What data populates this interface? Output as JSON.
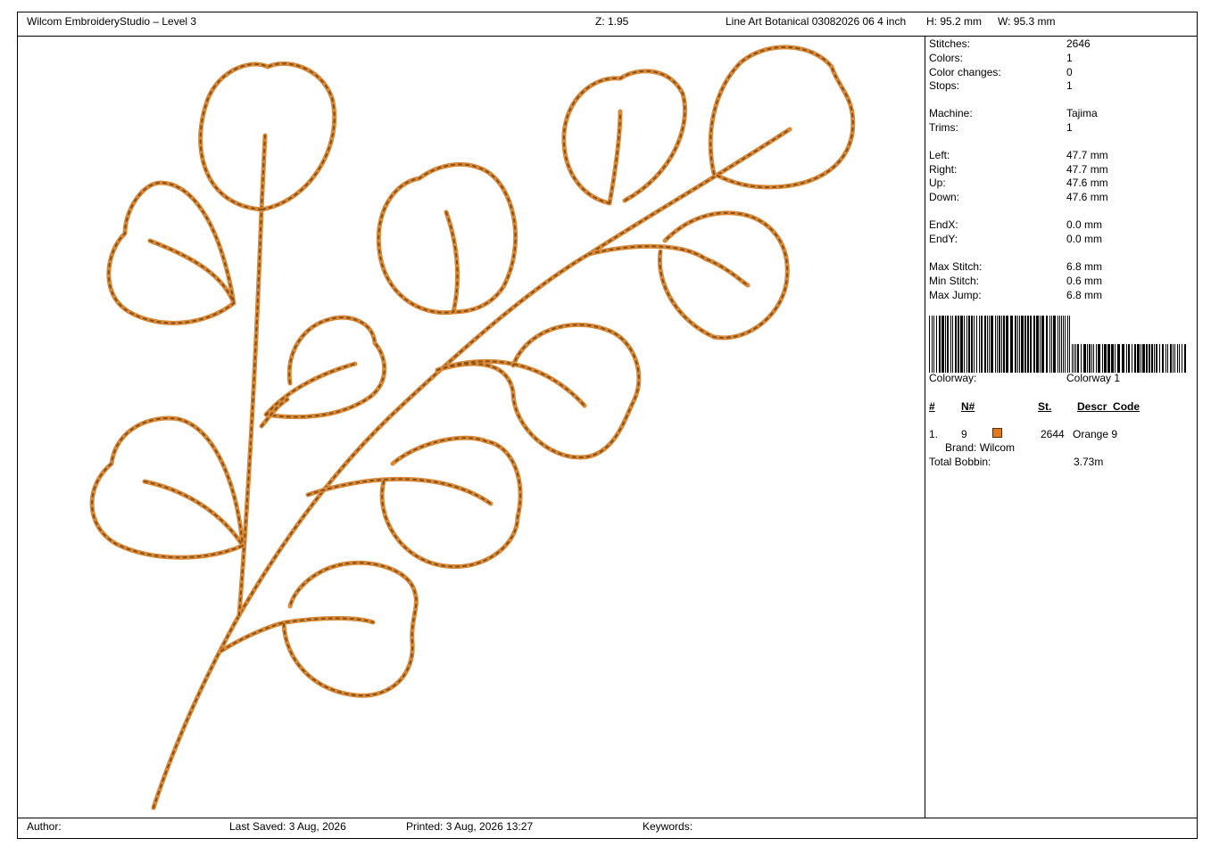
{
  "header": {
    "app_title": "Wilcom EmbroideryStudio – Level 3",
    "zoom": "Z: 1.95",
    "design_name": "Line Art Botanical 03082026 06 4  inch",
    "height": "H: 95.2 mm",
    "width": "W: 95.3 mm"
  },
  "stats": [
    {
      "label": "Stitches:",
      "value": "2646"
    },
    {
      "label": "Colors:",
      "value": "1"
    },
    {
      "label": "Color changes:",
      "value": "0"
    },
    {
      "label": "Stops:",
      "value": "1"
    },
    {
      "label": "Machine:",
      "value": "Tajima"
    },
    {
      "label": "Trims:",
      "value": "1"
    },
    {
      "label": "Left:",
      "value": "47.7 mm"
    },
    {
      "label": "Right:",
      "value": "47.7 mm"
    },
    {
      "label": "Up:",
      "value": "47.6 mm"
    },
    {
      "label": "Down:",
      "value": "47.6 mm"
    },
    {
      "label": "EndX:",
      "value": "0.0 mm"
    },
    {
      "label": "EndY:",
      "value": "0.0 mm"
    },
    {
      "label": "Max Stitch:",
      "value": "6.8 mm"
    },
    {
      "label": "Min Stitch:",
      "value": "0.6 mm"
    },
    {
      "label": "Max Jump:",
      "value": "6.8 mm"
    }
  ],
  "colorway": {
    "label": "Colorway:",
    "value": "Colorway 1"
  },
  "color_table": {
    "headers": [
      "#",
      "N#",
      "St.",
      "Descr_Code"
    ],
    "rows": [
      {
        "index": "1.",
        "number": "9",
        "stitches": "2644",
        "description": "Orange 9",
        "brand": "Brand: Wilcom",
        "swatch": "#e07a1f"
      }
    ]
  },
  "bobbin": {
    "label": "Total Bobbin:",
    "value": "3.73m"
  },
  "footer": {
    "author_label": "Author:",
    "last_saved": "Last Saved:  3 Aug, 2026",
    "printed": "Printed:  3 Aug, 2026 13:27",
    "keywords_label": "Keywords:"
  },
  "thread": {
    "primary": "#d8893a",
    "shade": "#8a4f12"
  }
}
